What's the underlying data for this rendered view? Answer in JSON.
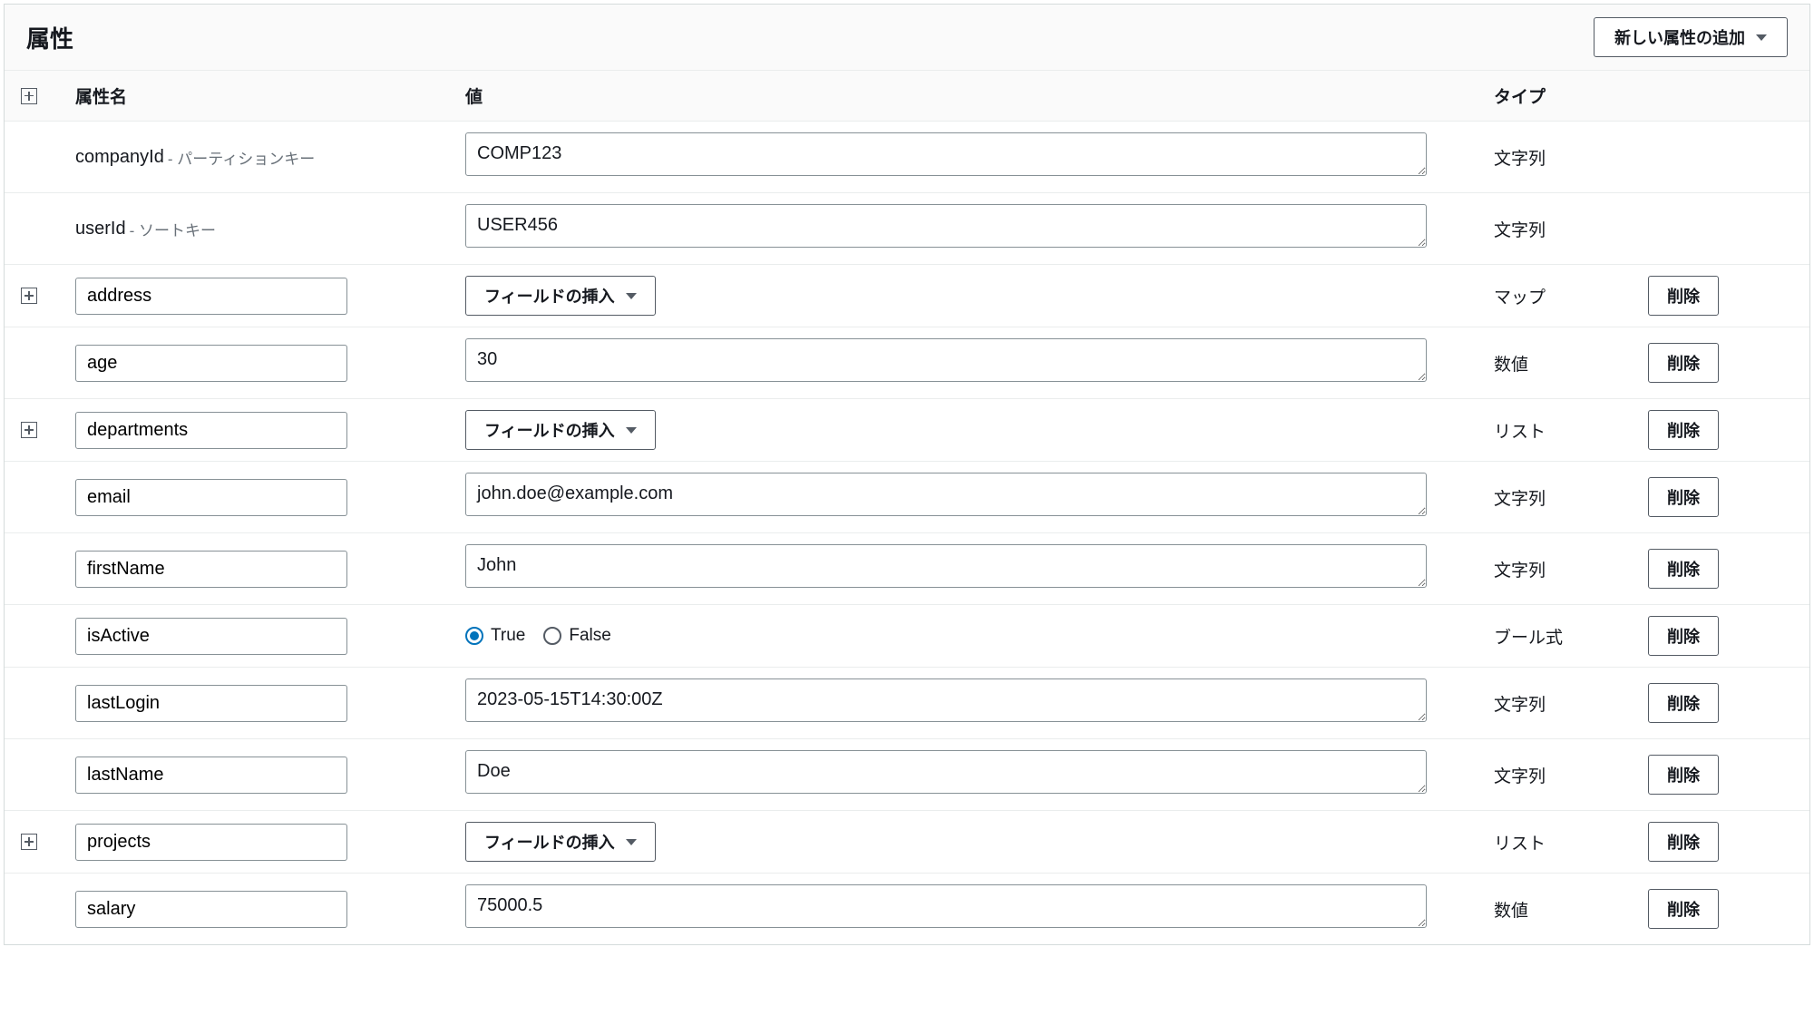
{
  "header": {
    "title": "属性",
    "addButton": "新しい属性の追加"
  },
  "columns": {
    "name": "属性名",
    "value": "値",
    "type": "タイプ"
  },
  "labels": {
    "insertField": "フィールドの挿入",
    "delete": "削除",
    "true": "True",
    "false": "False"
  },
  "keys": {
    "partition": "パーティションキー",
    "sort": "ソートキー"
  },
  "types": {
    "string": "文字列",
    "number": "数値",
    "map": "マップ",
    "list": "リスト",
    "bool": "ブール式"
  },
  "rows": [
    {
      "name": "companyId",
      "keyType": "partition",
      "valueKind": "text",
      "value": "COMP123",
      "type": "string",
      "editableName": false,
      "expandable": false,
      "deletable": false
    },
    {
      "name": "userId",
      "keyType": "sort",
      "valueKind": "text",
      "value": "USER456",
      "type": "string",
      "editableName": false,
      "expandable": false,
      "deletable": false
    },
    {
      "name": "address",
      "valueKind": "insert",
      "type": "map",
      "editableName": true,
      "expandable": true,
      "deletable": true
    },
    {
      "name": "age",
      "valueKind": "text",
      "value": "30",
      "type": "number",
      "editableName": true,
      "expandable": false,
      "deletable": true
    },
    {
      "name": "departments",
      "valueKind": "insert",
      "type": "list",
      "editableName": true,
      "expandable": true,
      "deletable": true
    },
    {
      "name": "email",
      "valueKind": "text",
      "value": "john.doe@example.com",
      "type": "string",
      "editableName": true,
      "expandable": false,
      "deletable": true
    },
    {
      "name": "firstName",
      "valueKind": "text",
      "value": "John",
      "type": "string",
      "editableName": true,
      "expandable": false,
      "deletable": true
    },
    {
      "name": "isActive",
      "valueKind": "bool",
      "value": true,
      "type": "bool",
      "editableName": true,
      "expandable": false,
      "deletable": true
    },
    {
      "name": "lastLogin",
      "valueKind": "text",
      "value": "2023-05-15T14:30:00Z",
      "type": "string",
      "editableName": true,
      "expandable": false,
      "deletable": true
    },
    {
      "name": "lastName",
      "valueKind": "text",
      "value": "Doe",
      "type": "string",
      "editableName": true,
      "expandable": false,
      "deletable": true
    },
    {
      "name": "projects",
      "valueKind": "insert",
      "type": "list",
      "editableName": true,
      "expandable": true,
      "deletable": true
    },
    {
      "name": "salary",
      "valueKind": "text",
      "value": "75000.5",
      "type": "number",
      "editableName": true,
      "expandable": false,
      "deletable": true
    }
  ]
}
